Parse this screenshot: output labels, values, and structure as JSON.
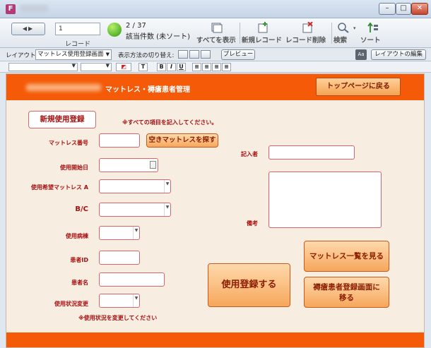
{
  "toolbar": {
    "record_value": "1",
    "record_label": "レコード",
    "found_count": "2 / 37",
    "found_label": "該当件数 (未ソート)",
    "show_all_label": "すべてを表示",
    "new_record_label": "新規レコード",
    "delete_record_label": "レコード削除",
    "find_label": "検索",
    "sort_label": "ソート"
  },
  "layoutbar": {
    "layout_label": "レイアウト:",
    "layout_value": "マットレス使用登録画面",
    "view_as_label": "表示方法の切り替え:",
    "preview_label": "プレビュー",
    "edit_layout_label": "レイアウトの編集"
  },
  "formatbar": {
    "text_style_label": "T",
    "bold_label": "B",
    "italic_label": "I",
    "underline_label": "U"
  },
  "form": {
    "title": "マットレス・褥瘡患者管理",
    "top_page_button": "トップページに戻る",
    "section_title": "新規使用登録",
    "instruction": "※すべての項目を記入してください。",
    "labels": {
      "mattress_number": "マットレス番号",
      "start_date": "使用開始日",
      "desired_mattress_a": "使用希望マットレス A",
      "bc": "B/C",
      "ward": "使用病棟",
      "patient_id": "患者ID",
      "patient_name": "患者名",
      "status_change": "使用状況変更",
      "recorder": "記入者",
      "remarks": "備考"
    },
    "status_note": "※使用状況を変更してください",
    "buttons": {
      "find_empty_mattress": "空きマットレスを探す",
      "register": "使用登録する",
      "mattress_list": "マットレス一覧を見る",
      "pressure_ulcer_line1": "褥瘡患者登録画面に",
      "pressure_ulcer_line2": "移る"
    }
  },
  "colors": {
    "header_orange": "#f45a08",
    "label_red": "#a50f0f",
    "form_background": "#f7ede1",
    "button_orange": "#f6a75c"
  }
}
